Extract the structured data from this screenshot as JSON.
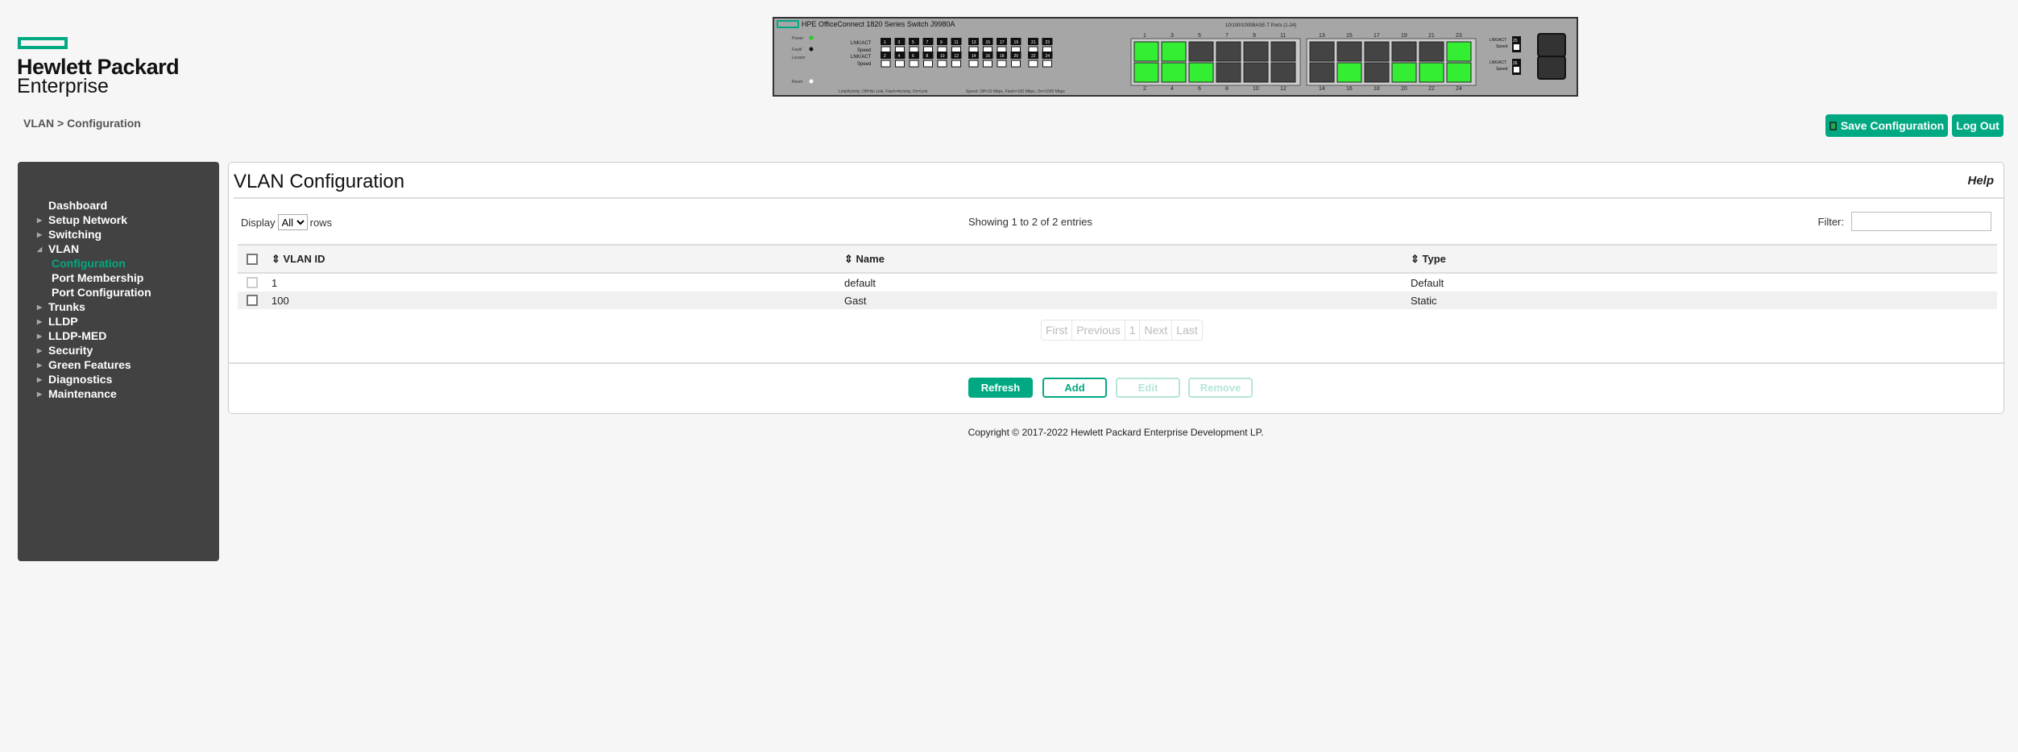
{
  "logo": {
    "line1": "Hewlett Packard",
    "line2": "Enterprise"
  },
  "breadcrumb": "VLAN > Configuration",
  "switch": {
    "model": "HPE OfficeConnect 1820 Series Switch J9980A",
    "ports_title": "10/100/1000BASE-T Ports (1-24)",
    "led_labels": {
      "power": "Power",
      "fault": "Fault/",
      "locator": "Locator",
      "reset": "Reset",
      "lnk": "LNK/ACT",
      "speed": "Speed"
    },
    "legend_link": "Link/Activity: Off=No Link, Flash=Activity, On=Link",
    "legend_speed": "Speed: Off=10 Mbps, Flash=100 Mbps, On=1000 Mbps",
    "sfp_ports": [
      "25",
      "26"
    ],
    "ports_linked": [
      1,
      2,
      3,
      4,
      6,
      16,
      20,
      22,
      23,
      24
    ],
    "colors": {
      "link": "#33ee33",
      "idle": "#444444"
    }
  },
  "toolbar": {
    "save_label": "Save Configuration",
    "logout_label": "Log Out",
    "save_icon": "floppy-icon"
  },
  "sidebar": {
    "items": [
      {
        "label": "Dashboard",
        "arrow": ""
      },
      {
        "label": "Setup Network",
        "arrow": "▶"
      },
      {
        "label": "Switching",
        "arrow": "▶"
      },
      {
        "label": "VLAN",
        "arrow": "◢"
      },
      {
        "label": "Configuration",
        "sub": true,
        "active": true
      },
      {
        "label": "Port Membership",
        "sub": true
      },
      {
        "label": "Port Configuration",
        "sub": true
      },
      {
        "label": "Trunks",
        "arrow": "▶"
      },
      {
        "label": "LLDP",
        "arrow": "▶"
      },
      {
        "label": "LLDP-MED",
        "arrow": "▶"
      },
      {
        "label": "Security",
        "arrow": "▶"
      },
      {
        "label": "Green Features",
        "arrow": "▶"
      },
      {
        "label": "Diagnostics",
        "arrow": "▶"
      },
      {
        "label": "Maintenance",
        "arrow": "▶"
      }
    ]
  },
  "main": {
    "title": "VLAN Configuration",
    "help": "Help",
    "display_label": "Display",
    "display_value": "All",
    "rows_label": "rows",
    "showing": "Showing 1 to 2 of 2 entries",
    "filter_label": "Filter:",
    "filter_value": "",
    "columns": [
      "VLAN ID",
      "Name",
      "Type"
    ],
    "rows": [
      {
        "id": "1",
        "name": "default",
        "type": "Default"
      },
      {
        "id": "100",
        "name": "Gast",
        "type": "Static"
      }
    ],
    "pager": [
      "First",
      "Previous",
      "1",
      "Next",
      "Last"
    ],
    "buttons": {
      "refresh": "Refresh",
      "add": "Add",
      "edit": "Edit",
      "remove": "Remove"
    }
  },
  "footer": "Copyright © 2017-2022 Hewlett Packard Enterprise Development LP.",
  "colors": {
    "accent": "#01a982",
    "sidebar": "#424242"
  }
}
